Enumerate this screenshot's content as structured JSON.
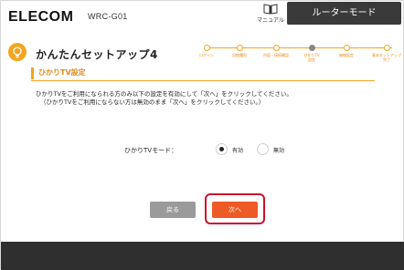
{
  "header": {
    "brand": "ELECOM",
    "model": "WRC-G01",
    "manual_label": "マニュアル",
    "mode_tab": "ルーターモード"
  },
  "wizard": {
    "title": "かんたんセットアップ4",
    "steps": [
      {
        "label": "ログイン"
      },
      {
        "label": "回線種別"
      },
      {
        "label": "内容・接続確認"
      },
      {
        "label": "ひかりTV\n設定"
      },
      {
        "label": "無線設定"
      },
      {
        "label": "基本セットアップ\n完了"
      }
    ],
    "active_step_index": 3
  },
  "section": {
    "title": "ひかりTV設定",
    "description_line1": "ひかりTVをご利用になられる方のみ以下の設定を有効にして「次へ」をクリックしてください。",
    "description_line2": "（ひかりTVをご利用にならない方は無効のまま「次へ」をクリックしてください。）"
  },
  "form": {
    "mode_label": "ひかりTVモード：",
    "option_enable": "有効",
    "option_disable": "無効",
    "selected": "有効"
  },
  "buttons": {
    "back": "戻る",
    "next": "次へ"
  },
  "colors": {
    "accent": "#f3a51f",
    "next_button": "#ee5a25",
    "highlight_border": "#c8102e",
    "footer": "#2f2f2f"
  }
}
